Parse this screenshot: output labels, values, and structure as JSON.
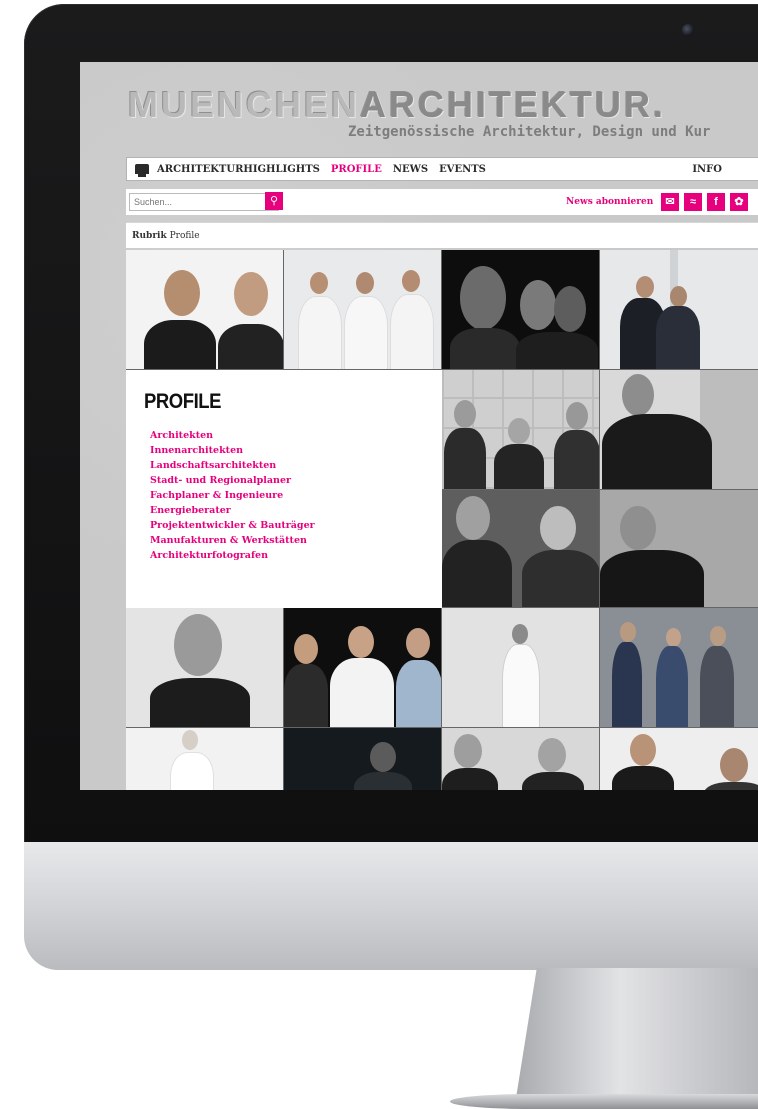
{
  "site": {
    "logo_light": "MUENCHEN",
    "logo_dark": "ARCHITEKTUR.",
    "tagline": "Zeitgenössische Architektur, Design und Kur"
  },
  "nav": {
    "items": [
      "ARCHITEKTURHIGHLIGHTS",
      "PROFILE",
      "NEWS",
      "EVENTS"
    ],
    "active": "PROFILE",
    "info": "INFO"
  },
  "toolbar": {
    "search_placeholder": "Suchen...",
    "subscribe_label": "News abonnieren",
    "social_icons": [
      "mail-icon",
      "rss-icon",
      "facebook-icon",
      "twitter-icon"
    ]
  },
  "breadcrumb": {
    "label": "Rubrik",
    "value": "Profile"
  },
  "profile": {
    "title": "PROFILE",
    "categories": [
      "Architekten",
      "Innenarchitekten",
      "Landschaftsarchitekten",
      "Stadt- und Regionalplaner",
      "Fachplaner & Ingenieure",
      "Energieberater",
      "Projektentwickler & Bauträger",
      "Manufakturen & Werkstätten",
      "Architekturfotografen"
    ]
  },
  "colors": {
    "accent": "#e6007e",
    "bezel": "#121213",
    "aluminum": "#cfd1d4"
  }
}
